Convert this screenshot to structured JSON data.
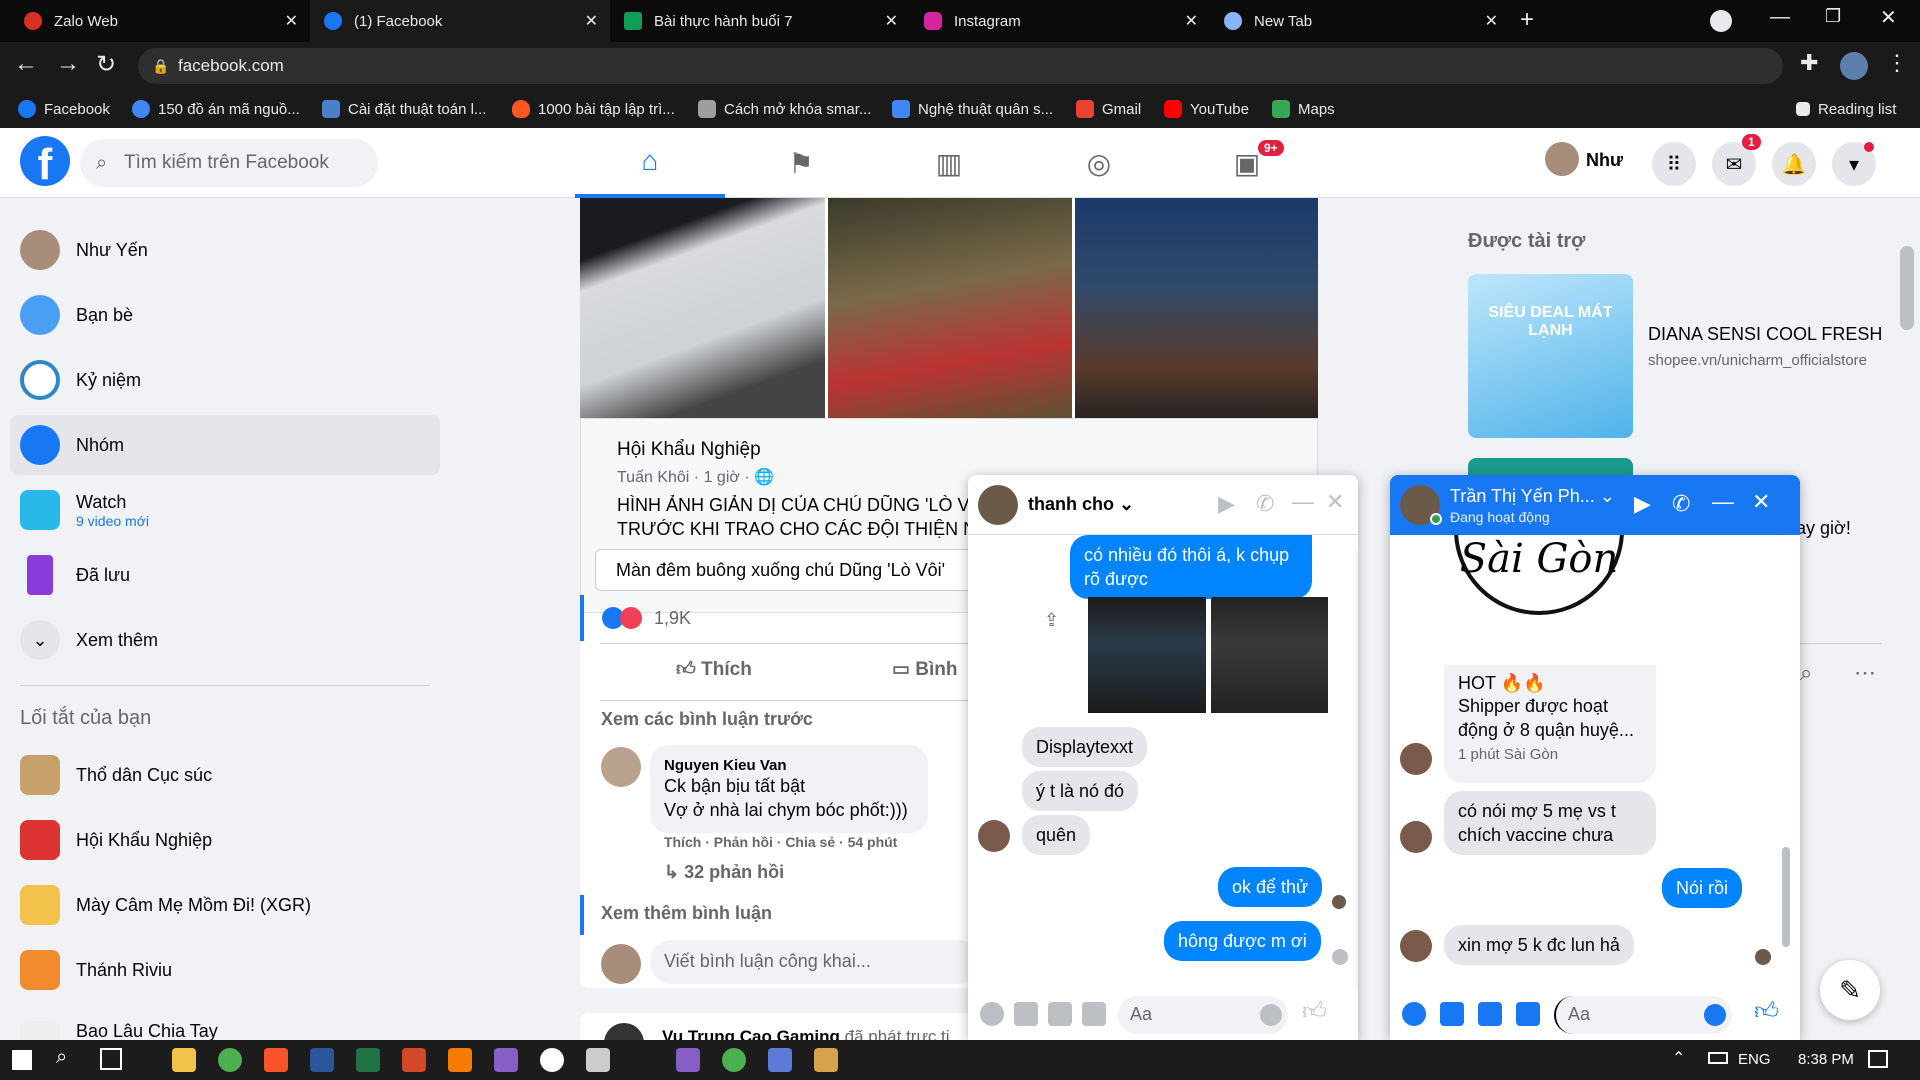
{
  "browser": {
    "tabs": [
      {
        "label": "Zalo Web",
        "icon": "zalo-icon",
        "color": "#d93025"
      },
      {
        "label": "(1) Facebook",
        "icon": "facebook-icon",
        "color": "#1877f2"
      },
      {
        "label": "Bài thực hành buổi 7",
        "icon": "classroom-icon",
        "color": "#0f9d58"
      },
      {
        "label": "Instagram",
        "icon": "instagram-icon",
        "color": "#d6249f"
      },
      {
        "label": "New Tab",
        "icon": "chrome-icon",
        "color": "#8ab4f8"
      }
    ],
    "url": "facebook.com",
    "bookmarks": [
      {
        "label": "Facebook",
        "color": "#1877f2"
      },
      {
        "label": "150 đồ án mã nguồ...",
        "color": "#4285f4"
      },
      {
        "label": "Cài đặt thuật toán l...",
        "color": "#4a80c8"
      },
      {
        "label": "1000 bài tập lập trì...",
        "color": "#ff5722"
      },
      {
        "label": "Cách mở khóa smar...",
        "color": "#9e9e9e"
      },
      {
        "label": "Nghệ thuật quân s...",
        "color": "#4285f4"
      },
      {
        "label": "Gmail",
        "color": "#ea4335"
      },
      {
        "label": "YouTube",
        "color": "#ff0000"
      },
      {
        "label": "Maps",
        "color": "#34a853"
      }
    ],
    "reading_list": "Reading list"
  },
  "fb": {
    "search_placeholder": "Tìm kiếm trên Facebook",
    "user_name": "Như",
    "messenger_badge": "1",
    "groups_badge": "9+"
  },
  "sidebar": {
    "items": [
      {
        "label": "Như Yến",
        "icon": "avatar"
      },
      {
        "label": "Bạn bè",
        "icon": "friends-icon"
      },
      {
        "label": "Kỷ niệm",
        "icon": "memories-icon"
      },
      {
        "label": "Nhóm",
        "icon": "groups-icon"
      },
      {
        "label": "Watch",
        "icon": "watch-icon",
        "sub": "9 video mới"
      },
      {
        "label": "Đã lưu",
        "icon": "saved-icon"
      },
      {
        "label": "Xem thêm",
        "icon": "chevron-down-icon"
      }
    ],
    "shortcuts_title": "Lối tắt của bạn",
    "shortcuts": [
      {
        "label": "Thổ dân Cục súc"
      },
      {
        "label": "Hội Khẩu Nghiệp"
      },
      {
        "label": "Mày Câm Mẹ Mồm Đi! (XGR)"
      },
      {
        "label": "Thánh Riviu"
      },
      {
        "label": "Bao Lâu Chia Tay"
      }
    ]
  },
  "post": {
    "group": "Hội Khẩu Nghiệp",
    "author": "Tuấn Khôi",
    "time": "· 1 giờ ·",
    "text1": "HÌNH ẢNH GIẢN DỊ CỦA CHÚ DŨNG 'LÒ V",
    "text2": "TRƯỚC KHI TRAO CHO CÁC ĐỘI THIỆN NG",
    "text3": "Màn đêm buông xuống chú Dũng 'Lò Vôi'",
    "reactions": "1,9K",
    "like": "Thích",
    "comment": "Bình",
    "prev_comments": "Xem các bình luận trước",
    "comment_author": "Nguyen Kieu Van",
    "comment_line1": "Ck bận bịu tất bật",
    "comment_line2": "Vợ ở nhà lai chym bóc phốt:)))",
    "comment_actions": "Thích · Phản hồi · Chia sẻ · 54 phút",
    "replies": "32 phản hồi",
    "more_comments": "Xem thêm bình luận",
    "write_placeholder": "Viết bình luận công khai...",
    "next_post_author": "Vu Trung Cao Gaming",
    "next_post_rest": "đã phát trực ti"
  },
  "sponsored": {
    "title": "Được tài trợ",
    "ad_title": "DIANA SENSI COOL FRESH",
    "ad_url": "shopee.vn/unicharm_officialstore",
    "ad_image_text": "SIÊU DEAL MÁT LẠNH",
    "partial_text": "ay giờ!"
  },
  "chat1": {
    "name": "thanh cho",
    "messages": [
      {
        "dir": "out",
        "text": "có nhiều đó thôi á, k chụp rõ được"
      },
      {
        "dir": "in",
        "text": "Displaytexxt"
      },
      {
        "dir": "in",
        "text": "ý t là nó đó"
      },
      {
        "dir": "in",
        "text": "quên"
      },
      {
        "dir": "out",
        "text": "ok để thử"
      },
      {
        "dir": "out",
        "text": "hông được m ơi"
      }
    ],
    "input_placeholder": "Aa"
  },
  "chat2": {
    "name": "Trần Thị Yến Ph...",
    "status": "Đang hoạt động",
    "card_title": "HOT 🔥🔥",
    "card_text": "Shipper được hoạt động ở 8 quận huyệ...",
    "card_meta": "1 phút Sài Gòn",
    "messages": [
      {
        "dir": "in",
        "text": "có nói mợ 5 mẹ vs t chích vaccine chưa"
      },
      {
        "dir": "out",
        "text": "Nói rồi"
      },
      {
        "dir": "in",
        "text": "xin mợ 5 k đc lun hả"
      }
    ],
    "input_placeholder": "Aa",
    "logo_text": "Sài Gòn"
  },
  "taskbar": {
    "lang": "ENG",
    "time": "8:38 PM"
  }
}
